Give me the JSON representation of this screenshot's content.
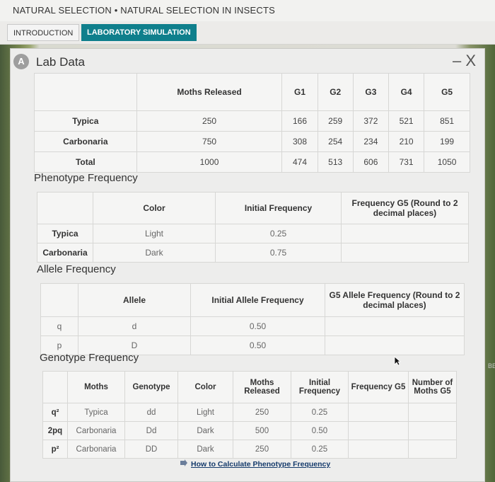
{
  "header": {
    "title": "NATURAL SELECTION • NATURAL SELECTION IN INSECTS"
  },
  "tabs": [
    {
      "label": "INTRODUCTION"
    },
    {
      "label": "LABORATORY SIMULATION"
    }
  ],
  "panel": {
    "title": "Lab Data",
    "close": "– X",
    "icon": "lab-data-icon"
  },
  "moths_table": {
    "headers": [
      "",
      "Moths Released",
      "G1",
      "G2",
      "G3",
      "G4",
      "G5"
    ],
    "rows": [
      {
        "label": "Typica",
        "values": [
          "250",
          "166",
          "259",
          "372",
          "521",
          "851"
        ]
      },
      {
        "label": "Carbonaria",
        "values": [
          "750",
          "308",
          "254",
          "234",
          "210",
          "199"
        ]
      },
      {
        "label": "Total",
        "values": [
          "1000",
          "474",
          "513",
          "606",
          "731",
          "1050"
        ]
      }
    ]
  },
  "phenotype": {
    "title": "Phenotype Frequency",
    "headers": [
      "",
      "Color",
      "Initial Frequency",
      "Frequency G5 (Round to 2 decimal places)"
    ],
    "rows": [
      {
        "label": "Typica",
        "color": "Light",
        "initial": "0.25",
        "g5": ""
      },
      {
        "label": "Carbonaria",
        "color": "Dark",
        "initial": "0.75",
        "g5": ""
      }
    ]
  },
  "allele": {
    "title": "Allele Frequency",
    "headers": [
      "",
      "Allele",
      "Initial Allele Frequency",
      "G5 Allele Frequency (Round to 2 decimal places)"
    ],
    "rows": [
      {
        "symbol": "q",
        "allele": "d",
        "initial": "0.50",
        "g5": ""
      },
      {
        "symbol": "p",
        "allele": "D",
        "initial": "0.50",
        "g5": ""
      }
    ]
  },
  "genotype": {
    "title": "Genotype Frequency",
    "headers": [
      "",
      "Moths",
      "Genotype",
      "Color",
      "Moths Released",
      "Initial Frequency",
      "Frequency G5",
      "Number of Moths G5"
    ],
    "rows": [
      {
        "symbol": "q²",
        "moth": "Typica",
        "genotype": "dd",
        "color": "Light",
        "released": "250",
        "initial": "0.25"
      },
      {
        "symbol": "2pq",
        "moth": "Carbonaria",
        "genotype": "Dd",
        "color": "Dark",
        "released": "500",
        "initial": "0.50"
      },
      {
        "symbol": "p²",
        "moth": "Carbonaria",
        "genotype": "DD",
        "color": "Dark",
        "released": "250",
        "initial": "0.25"
      }
    ]
  },
  "link": {
    "label": "How to Calculate Phenotype Frequency"
  },
  "side_text": "BELS"
}
